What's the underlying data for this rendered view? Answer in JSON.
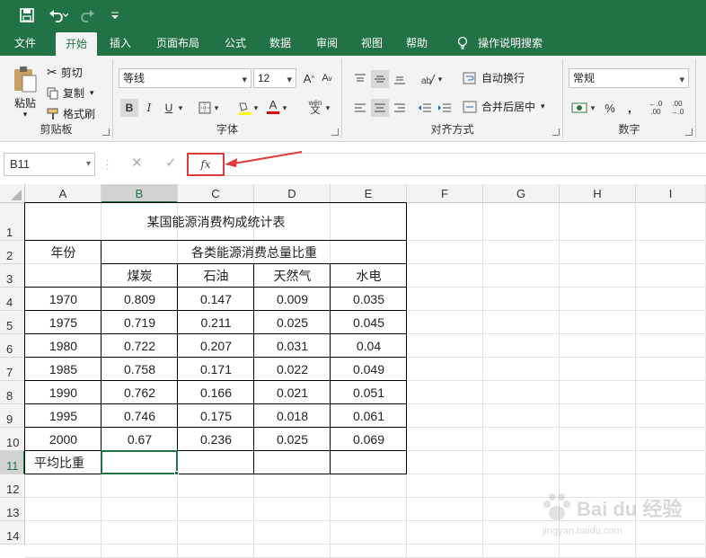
{
  "tabs": [
    "文件",
    "开始",
    "插入",
    "页面布局",
    "公式",
    "数据",
    "审阅",
    "视图",
    "帮助"
  ],
  "active_tab": "开始",
  "tell_me": "操作说明搜索",
  "ribbon": {
    "paste": "粘贴",
    "cut": "剪切",
    "copy": "复制",
    "format_painter": "格式刷",
    "clipboard": "剪贴板",
    "font_name": "等线",
    "font_size": "12",
    "font_group": "字体",
    "wrap_text": "自动换行",
    "merge_center": "合并后居中",
    "alignment": "对齐方式",
    "number_format": "常规",
    "number_group": "数字"
  },
  "formula_bar": {
    "name_box": "B11",
    "fx": "fx",
    "content": ""
  },
  "columns": [
    "A",
    "B",
    "C",
    "D",
    "E",
    "F",
    "G",
    "H",
    "I"
  ],
  "rows": [
    "1",
    "2",
    "3",
    "4",
    "5",
    "6",
    "7",
    "8",
    "9",
    "10",
    "11",
    "12",
    "13",
    "14"
  ],
  "selected": {
    "column": "B",
    "row": "11"
  },
  "sheet": {
    "title": "某国能源消费构成统计表",
    "year_header": "年份",
    "group_header": "各类能源消费总量比重",
    "sub_headers": [
      "煤炭",
      "石油",
      "天然气",
      "水电"
    ],
    "data": [
      [
        "1970",
        "0.809",
        "0.147",
        "0.009",
        "0.035"
      ],
      [
        "1975",
        "0.719",
        "0.211",
        "0.025",
        "0.045"
      ],
      [
        "1980",
        "0.722",
        "0.207",
        "0.031",
        "0.04"
      ],
      [
        "1985",
        "0.758",
        "0.171",
        "0.022",
        "0.049"
      ],
      [
        "1990",
        "0.762",
        "0.166",
        "0.021",
        "0.051"
      ],
      [
        "1995",
        "0.746",
        "0.175",
        "0.018",
        "0.061"
      ],
      [
        "2000",
        "0.67",
        "0.236",
        "0.025",
        "0.069"
      ]
    ],
    "avg_label": "平均比重"
  },
  "watermark": {
    "main": "Bai du 经验",
    "sub": "jingyan.baidu.com"
  },
  "colors": {
    "accent": "#217346",
    "annotation": "#e03a3a"
  }
}
